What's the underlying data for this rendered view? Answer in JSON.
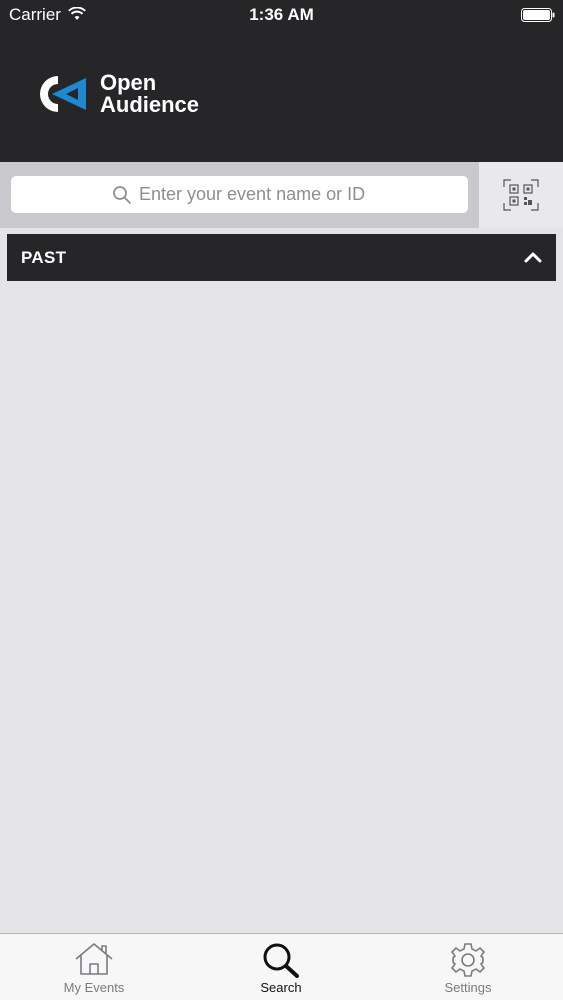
{
  "status_bar": {
    "carrier": "Carrier",
    "time": "1:36 AM"
  },
  "header": {
    "brand_line1": "Open",
    "brand_line2": "Audience"
  },
  "search": {
    "placeholder": "Enter your event name or ID",
    "value": ""
  },
  "section": {
    "title": "PAST"
  },
  "tabs": [
    {
      "label": "My Events",
      "icon": "home-icon",
      "active": false
    },
    {
      "label": "Search",
      "icon": "search-icon",
      "active": true
    },
    {
      "label": "Settings",
      "icon": "gear-icon",
      "active": false
    }
  ],
  "colors": {
    "header_bg": "#262628",
    "content_bg": "#e4e3e6",
    "brand_blue": "#1e88d2",
    "search_strip": "#c9c8cd"
  }
}
